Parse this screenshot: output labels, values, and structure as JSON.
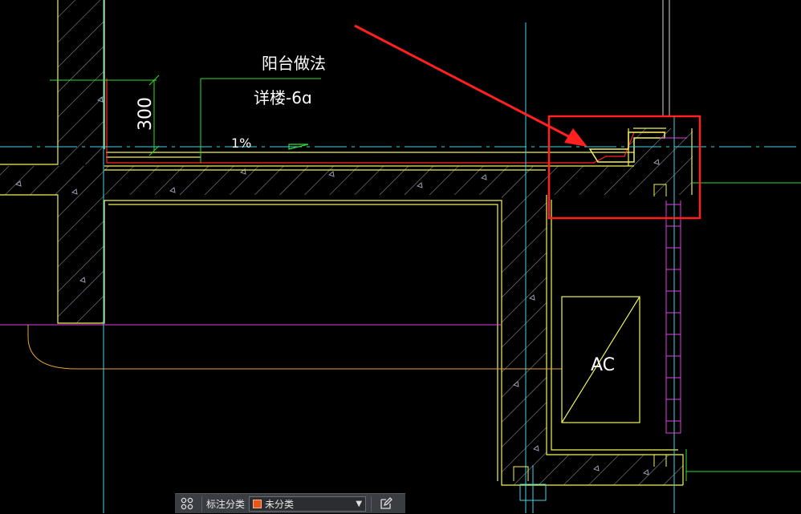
{
  "drawing": {
    "annotation_title": "阳台做法",
    "annotation_ref": "详楼-6ɑ",
    "dimension_value": "300",
    "slope_label": "1%",
    "equipment_label": "AC"
  },
  "toolbar": {
    "category_label": "标注分类",
    "selected_category": "未分类",
    "swatch_color": "#e8571e"
  },
  "colors": {
    "background": "#000000",
    "wall_outline": "#ffff66",
    "hatch": "#9aa0b0",
    "grid_line": "#35d7e8",
    "magenta_line": "#e040e0",
    "green_line": "#33dd33",
    "red_line": "#ff2020",
    "highlight_box": "#ff2020",
    "orange_curve": "#e6a23c"
  }
}
